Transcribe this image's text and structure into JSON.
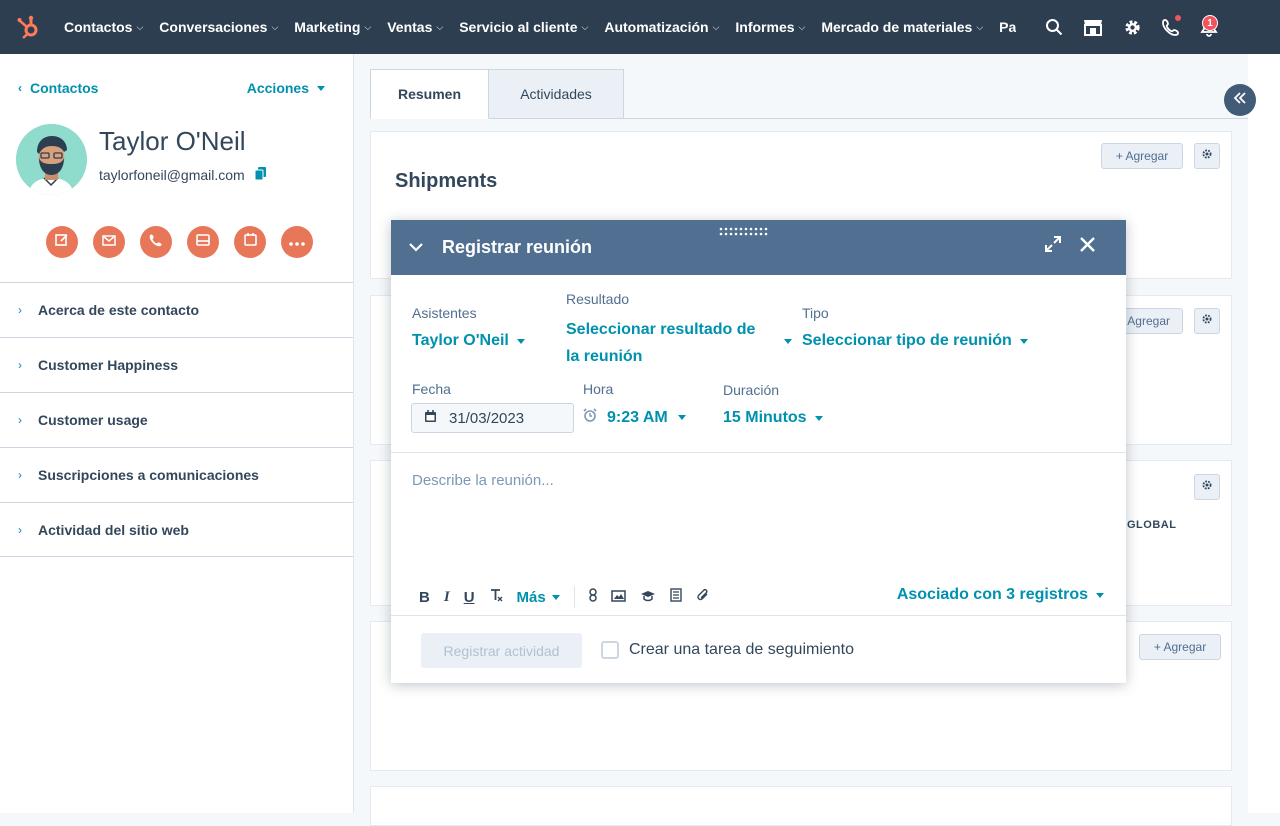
{
  "nav": {
    "items": [
      {
        "label": "Contactos"
      },
      {
        "label": "Conversaciones"
      },
      {
        "label": "Marketing"
      },
      {
        "label": "Ventas"
      },
      {
        "label": "Servicio al cliente"
      },
      {
        "label": "Automatización"
      },
      {
        "label": "Informes"
      },
      {
        "label": "Mercado de materiales"
      },
      {
        "label": "Part"
      }
    ],
    "notification_count": "1",
    "icons": [
      "hubspot-logo",
      "search-icon",
      "marketplace-icon",
      "gear-icon",
      "phone-icon",
      "bell-icon"
    ]
  },
  "sidebar": {
    "back_label": "Contactos",
    "actions_label": "Acciones",
    "contact": {
      "name": "Taylor O'Neil",
      "email": "taylorfoneil@gmail.com"
    },
    "action_icons": [
      "note-icon",
      "email-icon",
      "call-icon",
      "log-icon",
      "meeting-icon",
      "more-icon"
    ],
    "sections": [
      {
        "label": "Acerca de este contacto"
      },
      {
        "label": "Customer Happiness"
      },
      {
        "label": "Customer usage"
      },
      {
        "label": "Suscripciones a comunicaciones"
      },
      {
        "label": "Actividad del sitio web"
      }
    ]
  },
  "main": {
    "tabs": [
      {
        "label": "Resumen"
      },
      {
        "label": "Actividades"
      }
    ],
    "shipments_title": "Shipments",
    "add_label": "+ Agregar",
    "add_label_partial": "Agregar",
    "global_label": "GLOBAL"
  },
  "modal": {
    "title": "Registrar reunión",
    "attendees_label": "Asistentes",
    "attendees_value": "Taylor O'Neil",
    "result_label": "Resultado",
    "result_value_line1": "Seleccionar resultado de",
    "result_value_line2": "la reunión",
    "type_label": "Tipo",
    "type_value": "Seleccionar tipo de reunión",
    "date_label": "Fecha",
    "date_value": "31/03/2023",
    "time_label": "Hora",
    "time_value": "9:23 AM",
    "duration_label": "Duración",
    "duration_value": "15 Minutos",
    "description_placeholder": "Describe la reunión...",
    "toolbar_more": "Más",
    "associated": "Asociado con 3 registros",
    "submit_label": "Registrar actividad",
    "followup_label": "Crear una tarea de seguimiento"
  },
  "colors": {
    "nav_bg": "#2d3e50",
    "accent": "#0091ae",
    "action_orange": "#e8775a",
    "modal_header": "#516f90",
    "badge": "#f2545b"
  }
}
